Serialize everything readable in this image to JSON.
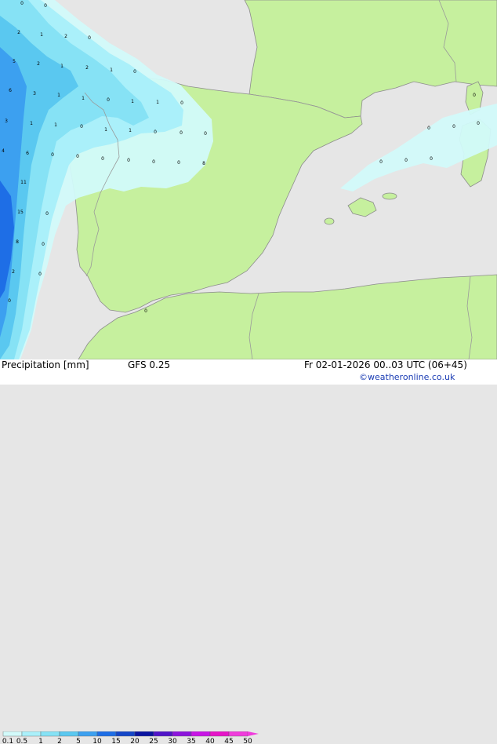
{
  "map": {
    "region": "Iberian Peninsula and Western Mediterranean",
    "colors": {
      "land": "#c6f09e",
      "sea": "#e6e6e6",
      "border": "#9a9a9a",
      "coast": "#8c8c8c",
      "rain_light": "#d2fafa",
      "rain_01_05": "#aaf0fa",
      "rain_05_1": "#86e2f5",
      "rain_1_2": "#5ac8f0",
      "rain_2_5": "#3ca0f0",
      "rain_5_10": "#1e6ee6"
    },
    "value_labels": [
      {
        "text": "0"
      },
      {
        "text": "0"
      },
      {
        "text": "2"
      },
      {
        "text": "1"
      },
      {
        "text": "2"
      },
      {
        "text": "0"
      },
      {
        "text": "5"
      },
      {
        "text": "2"
      },
      {
        "text": "1"
      },
      {
        "text": "2"
      },
      {
        "text": "1"
      },
      {
        "text": "0"
      },
      {
        "text": "6"
      },
      {
        "text": "3"
      },
      {
        "text": "1"
      },
      {
        "text": "1"
      },
      {
        "text": "0"
      },
      {
        "text": "1"
      },
      {
        "text": "1"
      },
      {
        "text": "0"
      },
      {
        "text": "3"
      },
      {
        "text": "1"
      },
      {
        "text": "1"
      },
      {
        "text": "0"
      },
      {
        "text": "1"
      },
      {
        "text": "1"
      },
      {
        "text": "0"
      },
      {
        "text": "0"
      },
      {
        "text": "0"
      },
      {
        "text": "4"
      },
      {
        "text": "6"
      },
      {
        "text": "0"
      },
      {
        "text": "0"
      },
      {
        "text": "0"
      },
      {
        "text": "0"
      },
      {
        "text": "0"
      },
      {
        "text": "0"
      },
      {
        "text": "8"
      },
      {
        "text": "11"
      },
      {
        "text": "0"
      },
      {
        "text": "15"
      },
      {
        "text": "0"
      },
      {
        "text": "8"
      },
      {
        "text": "0"
      },
      {
        "text": "2"
      },
      {
        "text": "0"
      },
      {
        "text": "0"
      },
      {
        "text": "0"
      },
      {
        "text": "0"
      },
      {
        "text": "0"
      },
      {
        "text": "0"
      },
      {
        "text": "0"
      },
      {
        "text": "0"
      },
      {
        "text": "0"
      }
    ]
  },
  "footer": {
    "title": "Precipitation [mm]",
    "model": "GFS 0.25",
    "datetime": "Fr 02-01-2026 00..03 UTC (06+45)",
    "credit": "©weatheronline.co.uk"
  },
  "legend": {
    "ticks": [
      "0.1",
      "0.5",
      "1",
      "2",
      "5",
      "10",
      "15",
      "20",
      "25",
      "30",
      "35",
      "40",
      "45",
      "50"
    ],
    "colors": [
      "#d2fafa",
      "#aaf0fa",
      "#86e2f5",
      "#5ac8f0",
      "#3ca0f0",
      "#1e6ee6",
      "#1446c8",
      "#0a14a0",
      "#5014c8",
      "#8c14dc",
      "#c814e6",
      "#e614c8",
      "#f03cdc"
    ]
  }
}
